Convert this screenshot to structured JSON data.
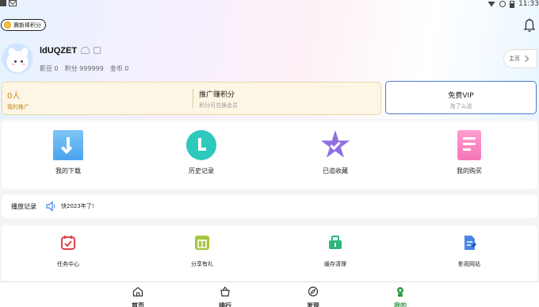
{
  "status_bar": {
    "time": "11:33"
  },
  "header": {
    "points_pill": "賽新棒积分",
    "username": "ldUQZET",
    "stats": [
      "影豆 0",
      "积分 999999",
      "金币 0"
    ],
    "homepage_label": "主页"
  },
  "promo": {
    "invite_count": "0人",
    "invite_sub": "我的推广",
    "earn_title": "推广赚积分",
    "earn_sub": "积分可兑换会员",
    "vip_title": "免费VIP",
    "vip_sub": "淘了么送"
  },
  "quick_actions": [
    {
      "label": "我的下载",
      "icon": "download-icon"
    },
    {
      "label": "历史记录",
      "icon": "history-icon"
    },
    {
      "label": "已追收藏",
      "icon": "favorite-star-icon"
    },
    {
      "label": "我的购买",
      "icon": "purchase-icon"
    }
  ],
  "play_history": {
    "label": "播放记录",
    "text": "快2023年了!"
  },
  "tools": [
    {
      "label": "任务中心",
      "icon": "task-center-icon",
      "color": "#e0424a"
    },
    {
      "label": "分享有礼",
      "icon": "gift-icon",
      "color": "#a3c63e"
    },
    {
      "label": "缓存清理",
      "icon": "cache-clean-icon",
      "color": "#2fb57a"
    },
    {
      "label": "影视网站",
      "icon": "website-icon",
      "color": "#4a86e8"
    }
  ],
  "tabs": [
    {
      "label": "首页",
      "icon": "home-icon",
      "active": false
    },
    {
      "label": "排行",
      "icon": "ranking-icon",
      "active": false
    },
    {
      "label": "发现",
      "icon": "discover-icon",
      "active": false
    },
    {
      "label": "我的",
      "icon": "profile-icon",
      "active": true
    }
  ],
  "colors": {
    "accent": "#2f9b45",
    "vip_border": "#4a7ad6",
    "promo_text": "#c4881a"
  }
}
